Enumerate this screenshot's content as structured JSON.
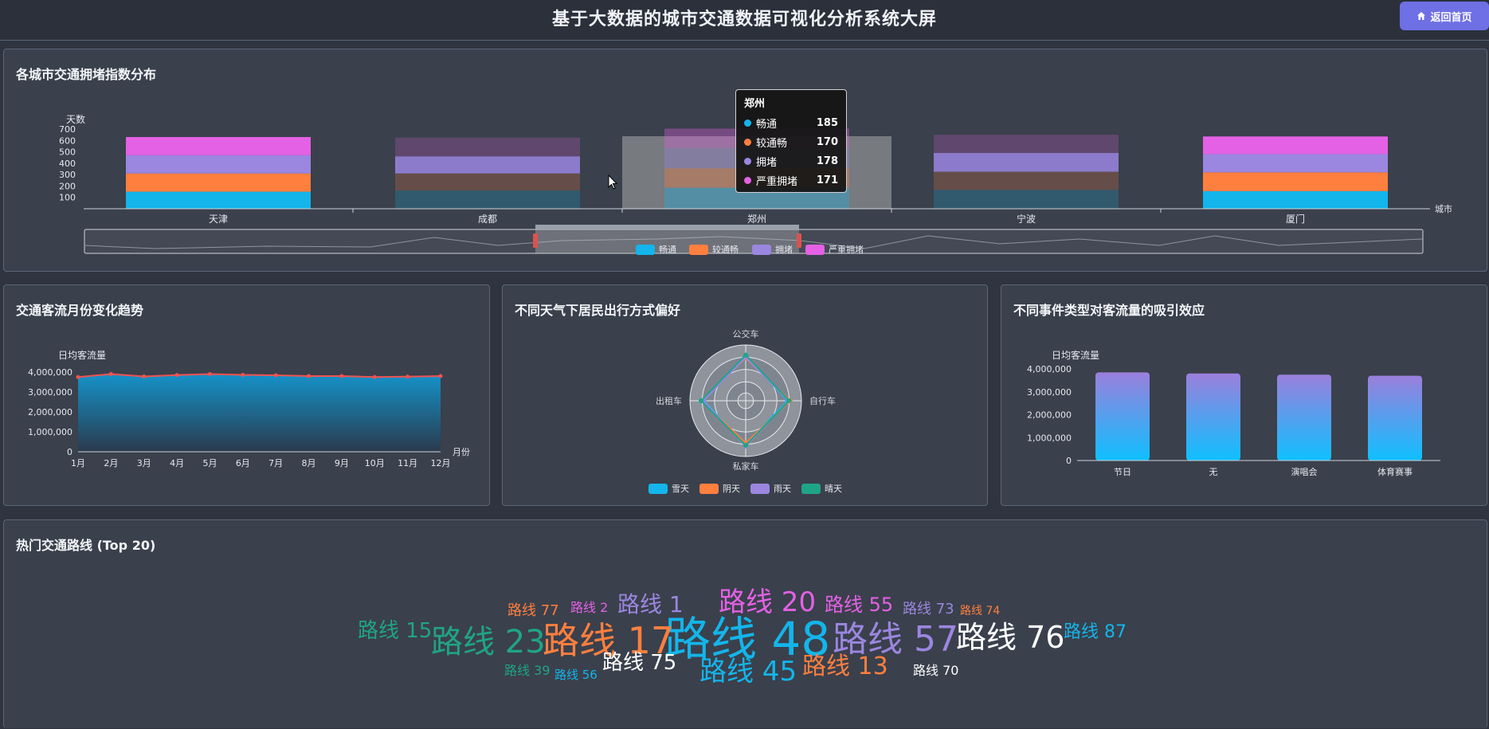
{
  "header": {
    "title": "基于大数据的城市交通数据可视化分析系统大屏",
    "back_label": "返回首页"
  },
  "panels": {
    "congestion": "各城市交通拥堵指数分布",
    "monthly": "交通客流月份变化趋势",
    "weather": "不同天气下居民出行方式偏好",
    "events": "不同事件类型对客流量的吸引效应",
    "routes": "热门交通路线 (Top 20)"
  },
  "tooltip": {
    "title": "郑州",
    "rows": [
      {
        "name": "畅通",
        "value": "185",
        "color": "#13b5ea"
      },
      {
        "name": "较通畅",
        "value": "170",
        "color": "#ff7f3f"
      },
      {
        "name": "拥堵",
        "value": "178",
        "color": "#9b86e0"
      },
      {
        "name": "严重拥堵",
        "value": "171",
        "color": "#e461e5"
      }
    ]
  },
  "chart_data": [
    {
      "type": "bar",
      "stacked": true,
      "categories": [
        "天津",
        "成都",
        "郑州",
        "宁波",
        "厦门"
      ],
      "ylabel": "天数",
      "xlabel": "城市",
      "ylim": [
        0,
        700
      ],
      "yticks": [
        "700",
        "600",
        "500",
        "400",
        "300",
        "200",
        "100"
      ],
      "series": [
        {
          "name": "畅通",
          "color": "#13b5ea",
          "values": [
            150,
            160,
            185,
            165,
            155
          ]
        },
        {
          "name": "较通畅",
          "color": "#ff7f3f",
          "values": [
            160,
            150,
            170,
            160,
            165
          ]
        },
        {
          "name": "拥堵",
          "color": "#9b86e0",
          "values": [
            160,
            150,
            178,
            165,
            160
          ]
        },
        {
          "name": "严重拥堵",
          "color": "#e461e5",
          "values": [
            160,
            165,
            171,
            160,
            155
          ]
        }
      ],
      "legend": "bottom",
      "highlight": "郑州"
    },
    {
      "type": "area",
      "categories": [
        "1月",
        "2月",
        "3月",
        "4月",
        "5月",
        "6月",
        "7月",
        "8月",
        "9月",
        "10月",
        "11月",
        "12月"
      ],
      "values": [
        3750000,
        3900000,
        3780000,
        3850000,
        3900000,
        3860000,
        3840000,
        3800000,
        3800000,
        3750000,
        3770000,
        3800000
      ],
      "ylabel": "日均客流量",
      "xlabel": "月份",
      "ylim": [
        0,
        4000000
      ],
      "yticks": [
        "4,000,000",
        "3,000,000",
        "2,000,000",
        "1,000,000",
        "0"
      ]
    },
    {
      "type": "radar",
      "indicators": [
        "公交车",
        "自行车",
        "私家车",
        "出租车"
      ],
      "series": [
        {
          "name": "雪天",
          "color": "#13b5ea",
          "values": [
            0.8,
            0.75,
            0.78,
            0.75
          ]
        },
        {
          "name": "阴天",
          "color": "#ff7f3f",
          "values": [
            0.77,
            0.8,
            0.76,
            0.78
          ]
        },
        {
          "name": "雨天",
          "color": "#9b86e0",
          "values": [
            0.78,
            0.77,
            0.82,
            0.76
          ]
        },
        {
          "name": "晴天",
          "color": "#1fa487",
          "values": [
            0.82,
            0.78,
            0.8,
            0.8
          ]
        }
      ],
      "legend": "bottom"
    },
    {
      "type": "bar",
      "categories": [
        "节日",
        "无",
        "演唱会",
        "体育赛事"
      ],
      "values": [
        3850000,
        3800000,
        3750000,
        3700000
      ],
      "ylabel": "日均客流量",
      "ylim": [
        0,
        4000000
      ],
      "yticks": [
        "4,000,000",
        "3,000,000",
        "2,000,000",
        "1,000,000",
        "0"
      ]
    }
  ],
  "wordcloud": [
    {
      "text": "路线 48",
      "color": "#13b5ea"
    },
    {
      "text": "路线 17",
      "color": "#ff7f3f"
    },
    {
      "text": "路线 57",
      "color": "#9b86e0"
    },
    {
      "text": "路线 23",
      "color": "#1fa487"
    },
    {
      "text": "路线 76",
      "color": "#ffffff"
    },
    {
      "text": "路线 20",
      "color": "#e461e5"
    },
    {
      "text": "路线 45",
      "color": "#13b5ea"
    },
    {
      "text": "路线 13",
      "color": "#ff7f3f"
    },
    {
      "text": "路线 15",
      "color": "#1fa487"
    },
    {
      "text": "路线 1",
      "color": "#9b86e0"
    },
    {
      "text": "路线 55",
      "color": "#e461e5"
    },
    {
      "text": "路线 75",
      "color": "#ffffff"
    },
    {
      "text": "路线 87",
      "color": "#13b5ea"
    },
    {
      "text": "路线 73",
      "color": "#9b86e0"
    },
    {
      "text": "路线 77",
      "color": "#ff7f3f"
    },
    {
      "text": "路线 70",
      "color": "#ffffff"
    },
    {
      "text": "路线 2",
      "color": "#e461e5"
    },
    {
      "text": "路线 39",
      "color": "#1fa487"
    },
    {
      "text": "路线 56",
      "color": "#13b5ea"
    },
    {
      "text": "路线 74",
      "color": "#ff7f3f"
    }
  ]
}
